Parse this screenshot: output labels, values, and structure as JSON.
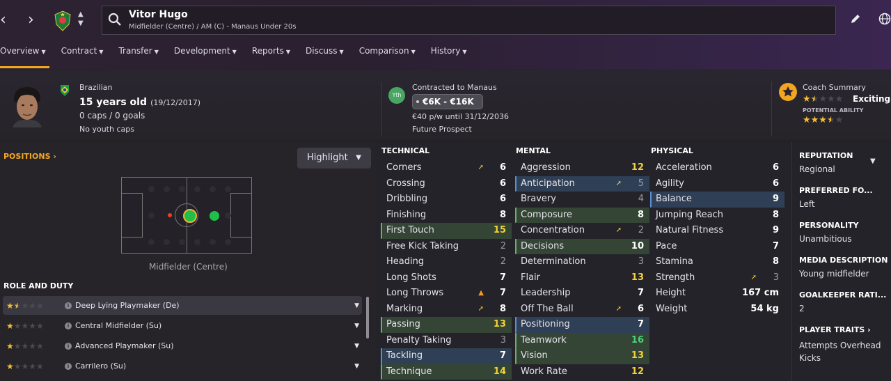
{
  "header": {
    "player_name": "Vitor Hugo",
    "player_subtitle": "Midfielder (Centre) / AM (C) - Manaus Under 20s",
    "back_icon": "chevron-left-icon",
    "forward_icon": "chevron-right-icon",
    "search_icon": "search-icon",
    "edit_icon": "pencil-icon",
    "globe_icon": "globe-icon"
  },
  "tabs": [
    {
      "label": "Overview"
    },
    {
      "label": "Contract"
    },
    {
      "label": "Transfer"
    },
    {
      "label": "Development"
    },
    {
      "label": "Reports"
    },
    {
      "label": "Discuss"
    },
    {
      "label": "Comparison"
    },
    {
      "label": "History"
    }
  ],
  "profile": {
    "nationality": "Brazilian",
    "age": "15 years old",
    "dob": "(19/12/2017)",
    "caps": "0 caps / 0 goals",
    "youth_caps": "No youth caps"
  },
  "contract": {
    "badge": "Yth",
    "title": "Contracted to Manaus",
    "wage_range": "€6K - €16K",
    "wage_detail": "€40 p/w until 31/12/2036",
    "status": "Future Prospect"
  },
  "coach": {
    "title": "Coach Summary",
    "summary": "Exciting y",
    "potential_label": "POTENTIAL ABILITY",
    "current_stars": 1.5,
    "potential_stars": 3.5
  },
  "positions": {
    "title": "POSITIONS",
    "highlight_label": "Highlight",
    "position_name": "Midfielder (Centre)"
  },
  "roles": {
    "title": "ROLE AND DUTY",
    "items": [
      {
        "label": "Deep Lying Playmaker (De)",
        "stars": 1.5
      },
      {
        "label": "Central Midfielder (Su)",
        "stars": 1
      },
      {
        "label": "Advanced Playmaker (Su)",
        "stars": 1
      },
      {
        "label": "Carrilero (Su)",
        "stars": 1
      }
    ]
  },
  "technical": {
    "title": "TECHNICAL",
    "rows": [
      {
        "name": "Corners",
        "value": "6",
        "icon": "up"
      },
      {
        "name": "Crossing",
        "value": "6"
      },
      {
        "name": "Dribbling",
        "value": "6"
      },
      {
        "name": "Finishing",
        "value": "8"
      },
      {
        "name": "First Touch",
        "value": "15"
      },
      {
        "name": "Free Kick Taking",
        "value": "2"
      },
      {
        "name": "Heading",
        "value": "2"
      },
      {
        "name": "Long Shots",
        "value": "7"
      },
      {
        "name": "Long Throws",
        "value": "7",
        "icon": "up-orange"
      },
      {
        "name": "Marking",
        "value": "8",
        "icon": "up"
      },
      {
        "name": "Passing",
        "value": "13"
      },
      {
        "name": "Penalty Taking",
        "value": "3"
      },
      {
        "name": "Tackling",
        "value": "7"
      },
      {
        "name": "Technique",
        "value": "14"
      }
    ]
  },
  "mental": {
    "title": "MENTAL",
    "rows": [
      {
        "name": "Aggression",
        "value": "12"
      },
      {
        "name": "Anticipation",
        "value": "5",
        "icon": "up"
      },
      {
        "name": "Bravery",
        "value": "4"
      },
      {
        "name": "Composure",
        "value": "8"
      },
      {
        "name": "Concentration",
        "value": "2",
        "icon": "up"
      },
      {
        "name": "Decisions",
        "value": "10"
      },
      {
        "name": "Determination",
        "value": "3"
      },
      {
        "name": "Flair",
        "value": "13"
      },
      {
        "name": "Leadership",
        "value": "7"
      },
      {
        "name": "Off The Ball",
        "value": "6",
        "icon": "up"
      },
      {
        "name": "Positioning",
        "value": "7"
      },
      {
        "name": "Teamwork",
        "value": "16"
      },
      {
        "name": "Vision",
        "value": "13"
      },
      {
        "name": "Work Rate",
        "value": "12"
      }
    ]
  },
  "physical": {
    "title": "PHYSICAL",
    "rows": [
      {
        "name": "Acceleration",
        "value": "6"
      },
      {
        "name": "Agility",
        "value": "6"
      },
      {
        "name": "Balance",
        "value": "9"
      },
      {
        "name": "Jumping Reach",
        "value": "8"
      },
      {
        "name": "Natural Fitness",
        "value": "9"
      },
      {
        "name": "Pace",
        "value": "7"
      },
      {
        "name": "Stamina",
        "value": "8"
      },
      {
        "name": "Strength",
        "value": "3",
        "icon": "up"
      },
      {
        "name": "Height",
        "value": "167 cm"
      },
      {
        "name": "Weight",
        "value": "54 kg"
      }
    ]
  },
  "sidebar": {
    "reputation_label": "REPUTATION",
    "reputation_value": "Regional",
    "foot_label": "PREFERRED FO...",
    "foot_value": "Left",
    "personality_label": "PERSONALITY",
    "personality_value": "Unambitious",
    "media_label": "MEDIA DESCRIPTION",
    "media_value": "Young midfielder",
    "gk_label": "GOALKEEPER RATI...",
    "gk_value": "2",
    "traits_label": "PLAYER TRAITS",
    "traits_value": "Attempts Overhead Kicks"
  },
  "colors": {
    "accent": "#f5a623",
    "highlight_green": "#344535",
    "highlight_blue": "#2f3f55",
    "value_gold": "#f2d23a",
    "value_green": "#4ed07a"
  }
}
